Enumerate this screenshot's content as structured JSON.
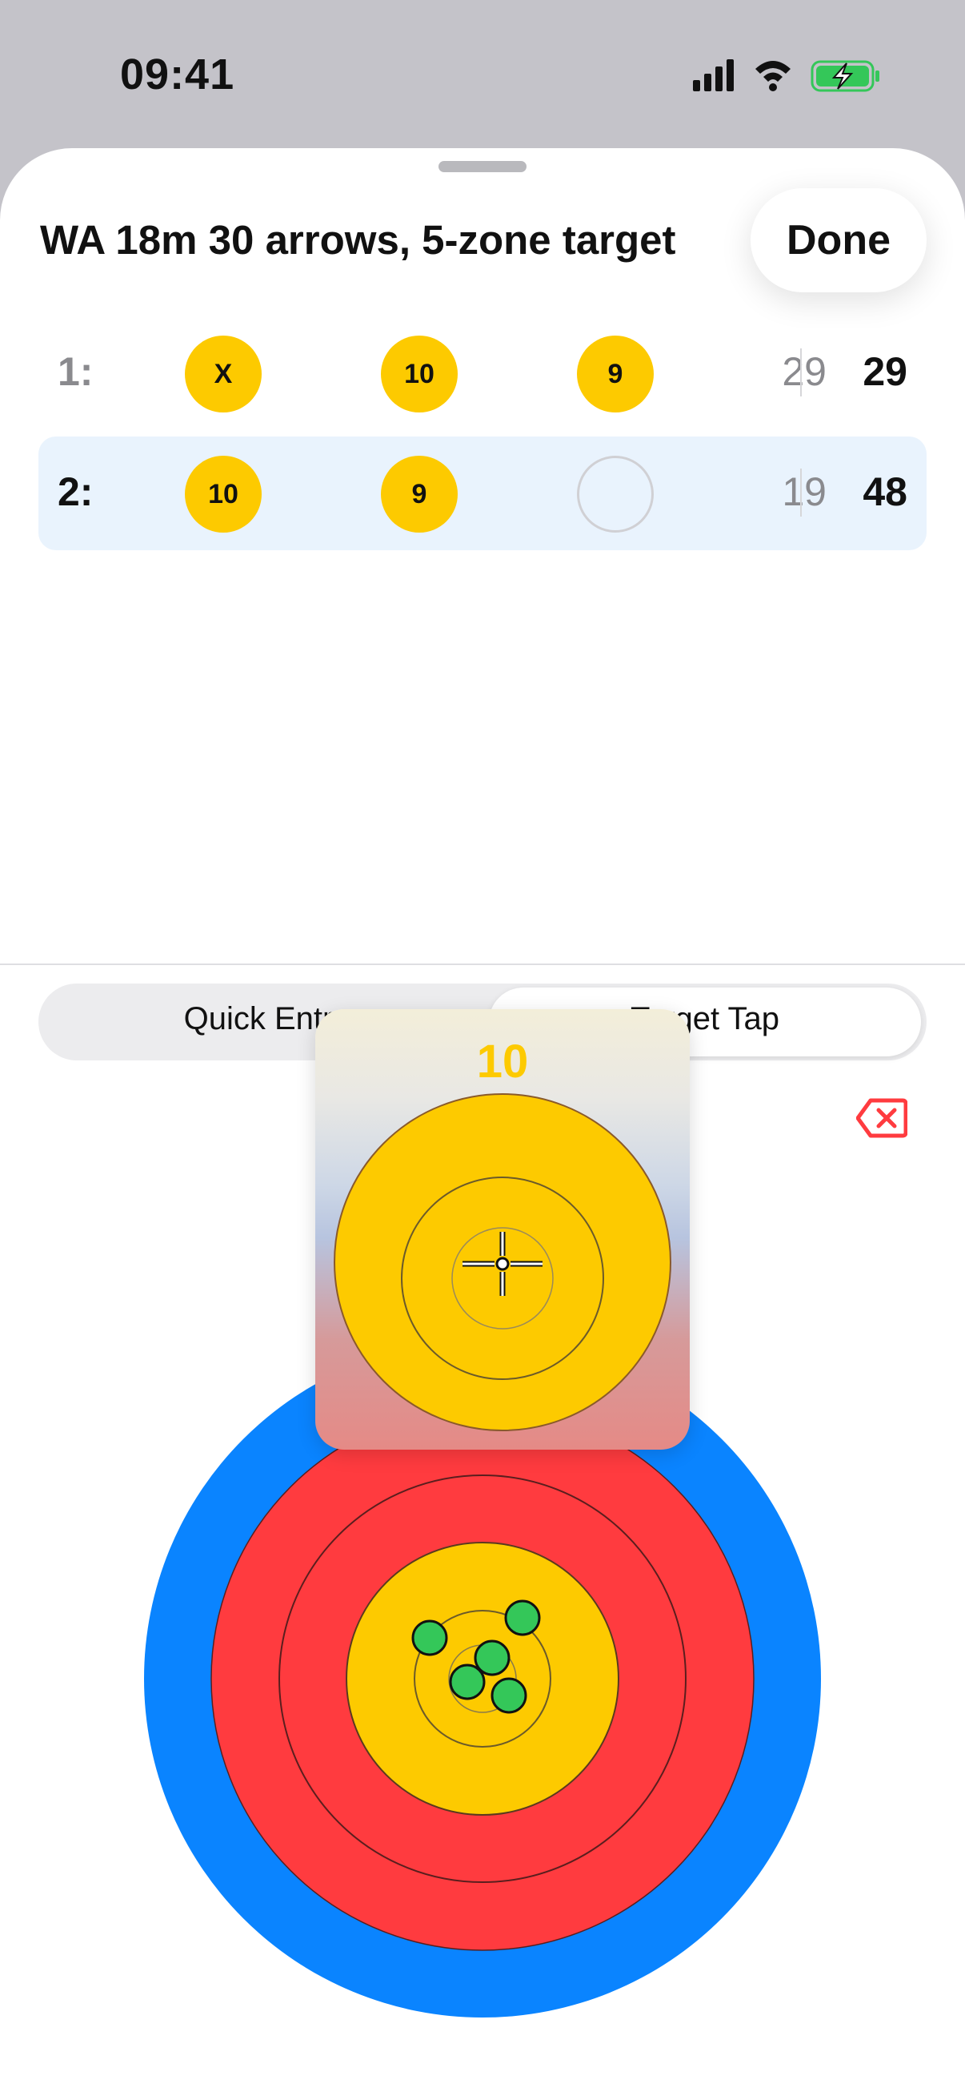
{
  "status_bar": {
    "time": "09:41",
    "icons": [
      "signal-icon",
      "wifi-icon",
      "battery-charging-icon"
    ],
    "battery_color": "#34c759"
  },
  "sheet": {
    "title": "WA 18m 30 arrows, 5-zone target",
    "done_label": "Done"
  },
  "ends": [
    {
      "label": "1:",
      "arrows": [
        "X",
        "10",
        "9"
      ],
      "end_total": "29",
      "running_total": "29",
      "active": false
    },
    {
      "label": "2:",
      "arrows": [
        "10",
        "9",
        ""
      ],
      "end_total": "19",
      "running_total": "48",
      "active": true
    }
  ],
  "entry_mode": {
    "options": [
      "Quick Entry",
      "Target Tap"
    ],
    "selected": "Target Tap"
  },
  "delete_icon": "delete-left-icon",
  "target": {
    "face": "5-zone",
    "colors": {
      "blue": "#0a84ff",
      "red": "#ff3b3f",
      "gold": "#fdca00",
      "arrow_marker": "#34c759"
    },
    "placed_arrow_count": 5
  },
  "magnifier": {
    "score": "10",
    "icon": "crosshair-icon"
  }
}
